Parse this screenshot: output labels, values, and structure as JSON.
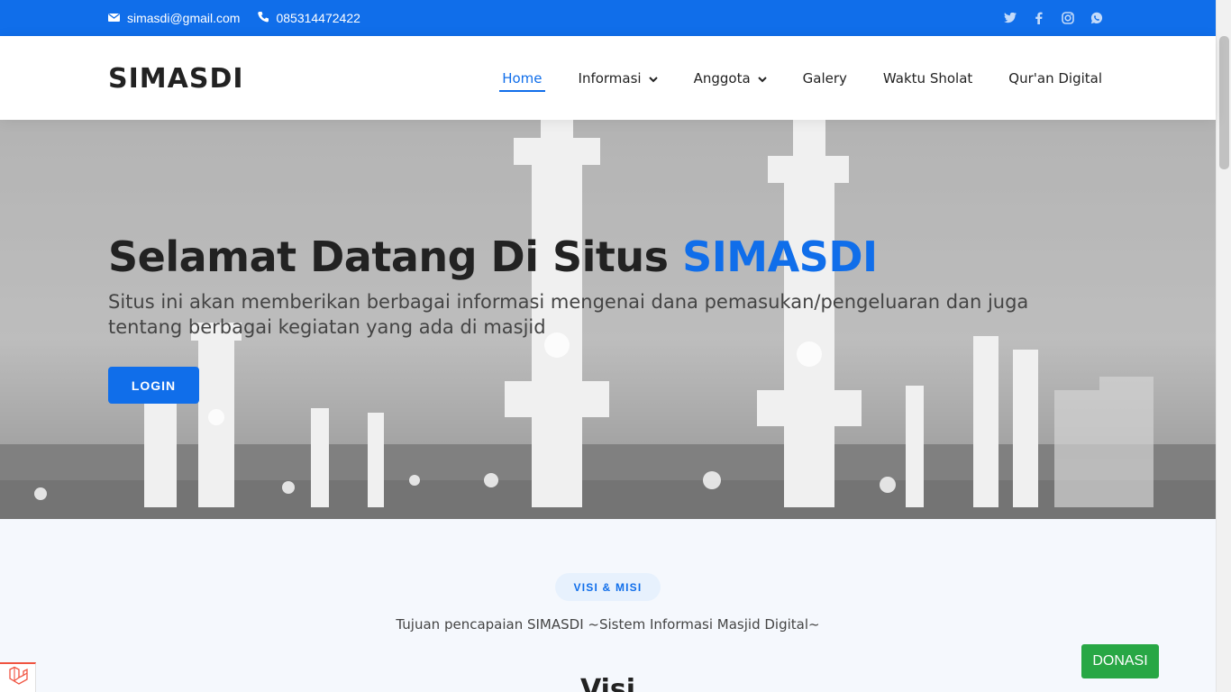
{
  "topbar": {
    "email": "simasdi@gmail.com",
    "phone": "085314472422",
    "email_icon": "envelope-icon",
    "phone_icon": "phone-icon",
    "social_icons": [
      "twitter-icon",
      "facebook-icon",
      "instagram-icon",
      "whatsapp-icon"
    ]
  },
  "header": {
    "logo": "SIMASDI",
    "nav": [
      {
        "label": "Home",
        "active": true
      },
      {
        "label": "Informasi",
        "dropdown": true
      },
      {
        "label": "Anggota",
        "dropdown": true
      },
      {
        "label": "Galery"
      },
      {
        "label": "Waktu Sholat"
      },
      {
        "label": "Qur'an Digital"
      }
    ]
  },
  "hero": {
    "title_prefix": "Selamat Datang Di Situs ",
    "title_accent": "SIMASDI",
    "subtitle": "Situs ini akan memberikan berbagai informasi mengenai dana pemasukan/pengeluaran dan juga tentang berbagai kegiatan yang ada di masjid",
    "login_label": "LOGIN"
  },
  "section": {
    "badge": "VISI & MISI",
    "description": "Tujuan pencapaian SIMASDI ~Sistem Informasi Masjid Digital~",
    "heading": "Visi"
  },
  "floating": {
    "donate_label": "DONASI"
  },
  "colors": {
    "primary": "#106eea",
    "donate": "#28a745",
    "section_bg": "#f5f8fd"
  }
}
